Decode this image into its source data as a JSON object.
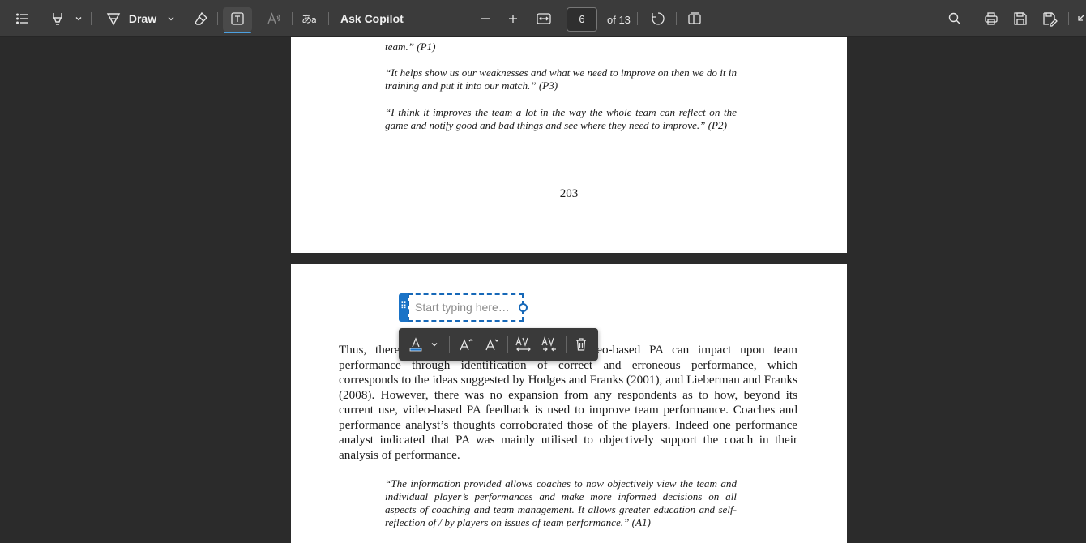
{
  "toolbar": {
    "draw_label": "Draw",
    "copilot_label": "Ask Copilot",
    "page_current": "6",
    "page_total": "of 13",
    "icons": [
      "contents-icon",
      "highlight-icon",
      "chevron-down-icon",
      "draw-icon",
      "erase-icon",
      "text-box-icon",
      "read-aloud-icon",
      "translate-icon",
      "zoom-out-icon",
      "zoom-in-icon",
      "fit-width-icon",
      "rotate-icon",
      "page-view-icon",
      "search-icon",
      "print-icon",
      "save-icon",
      "save-as-icon",
      "collapse-icon"
    ],
    "accent_color": "#4ca0e0"
  },
  "page_top": {
    "quote_fragment": "team.” (P1)",
    "quote_p3": "“It helps show us our weaknesses and what we need to improve on then we do it in training and put it into our match.” (P3)",
    "quote_p2": "“I think it improves the team a lot in the way the whole team can reflect on the game and notify good and bad things and see where they need to improve.” (P2)",
    "page_number": "203"
  },
  "page_bottom": {
    "para_start": "Thus, there",
    "para_rest": "eo-based PA can impact upon team performance through identification of correct and erroneous performance, which corresponds to the ideas suggested by Hodges and Franks (2001), and Lieberman and Franks (2008).  However, there was no expansion from any respondents as to how, beyond its current use, video-based PA feedback is used to improve team performance. Coaches and performance analyst’s thoughts corroborated those of the players.  Indeed one performance analyst indicated that PA was mainly utilised to objectively support the coach in their analysis of performance.",
    "quote_a1": "“The information provided allows coaches to now objectively view the team and individual player’s performances and make more informed decisions on all aspects of coaching and team management.  It allows greater education and self-reflection of / by players on issues of team performance.” (A1)"
  },
  "textbox": {
    "placeholder": "Start typing here…",
    "border_color": "#1668b8"
  },
  "format_toolbar": {
    "icons": [
      "font-color-icon",
      "chevron-down-icon",
      "increase-font-icon",
      "decrease-font-icon",
      "increase-spacing-icon",
      "decrease-spacing-icon",
      "delete-icon"
    ],
    "font_color_indicator": "#1a73c7"
  }
}
